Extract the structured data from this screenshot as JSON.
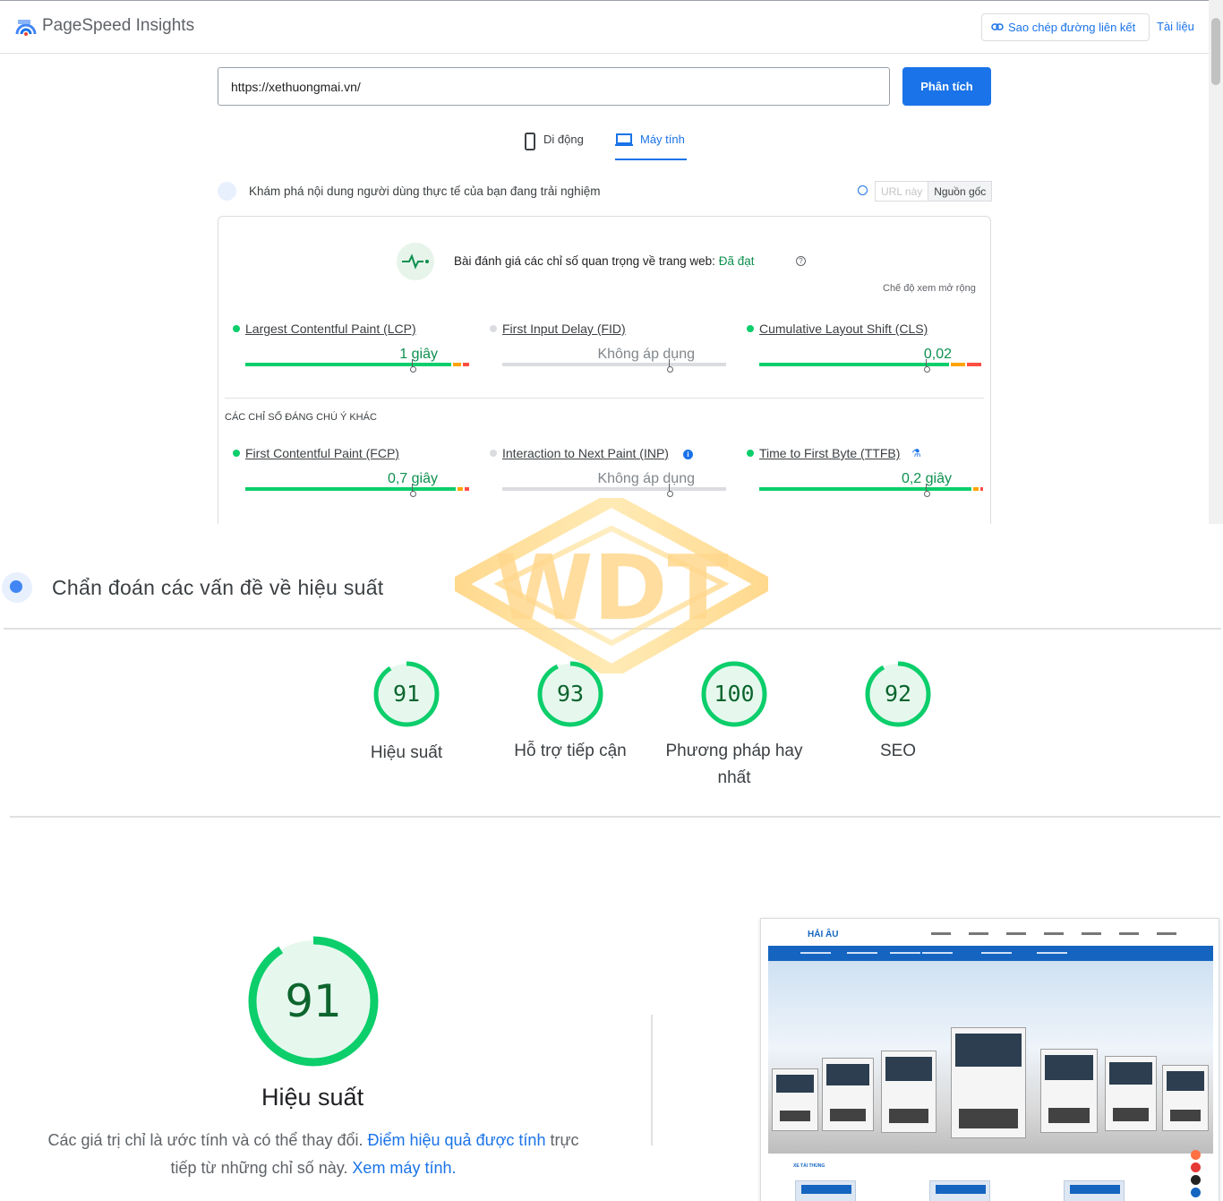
{
  "header": {
    "brand": "PageSpeed Insights",
    "copy_link": "Sao chép đường liên kết",
    "docs": "Tài liệu"
  },
  "search": {
    "url_value": "https://xethuongmai.vn/",
    "analyze_label": "Phân tích"
  },
  "tabs": [
    {
      "label": "Di động",
      "icon": "mobile-icon",
      "selected": false
    },
    {
      "label": "Máy tính",
      "icon": "desktop-icon",
      "selected": true
    }
  ],
  "field_data": {
    "title": "Khám phá nội dung người dùng thực tế của bạn đang trải nghiệm",
    "toggle": [
      "URL này",
      "Nguồn gốc"
    ],
    "toggle_selected": "Nguồn gốc",
    "assessment_text": "Bài đánh giá các chỉ số quan trọng về trang web:",
    "assessment_status": "Đã đạt",
    "expand_label": "Chế độ xem mở rộng",
    "other_metrics_label": "CÁC CHỈ SỐ ĐÁNG CHÚ Ý KHÁC",
    "metrics": [
      {
        "name": "Largest Contentful Paint (LCP)",
        "value": "1 giây",
        "status": "good"
      },
      {
        "name": "First Input Delay (FID)",
        "value": "Không áp dụng",
        "status": "na"
      },
      {
        "name": "Cumulative Layout Shift (CLS)",
        "value": "0,02",
        "status": "good"
      },
      {
        "name": "First Contentful Paint (FCP)",
        "value": "0,7 giây",
        "status": "good"
      },
      {
        "name": "Interaction to Next Paint (INP)",
        "value": "Không áp dụng",
        "status": "na"
      },
      {
        "name": "Time to First Byte (TTFB)",
        "value": "0,2 giây",
        "status": "good"
      }
    ]
  },
  "diagnostics": {
    "title": "Chẩn đoán các vấn đề về hiệu suất",
    "scores": [
      {
        "value": "91",
        "label": "Hiệu suất"
      },
      {
        "value": "93",
        "label": "Hỗ trợ tiếp cận"
      },
      {
        "value": "100",
        "label": "Phương pháp hay nhất"
      },
      {
        "value": "92",
        "label": "SEO"
      }
    ],
    "performance": {
      "score": "91",
      "title": "Hiệu suất",
      "note_text": "Các giá trị chỉ là ước tính và có thể thay đổi.",
      "note_link1": "Điểm hiệu quả được tính",
      "note_text2": "trực tiếp từ những chỉ số này.",
      "note_link2": "Xem máy tính."
    }
  },
  "thumbnail": {
    "logo": "HẢI ÂU",
    "section": "XE TẢI THÙNG"
  },
  "watermark": {
    "text": "WDT"
  },
  "colors": {
    "accent": "#1a73e8",
    "good": "#0cce6b",
    "average": "#ffa400",
    "poor": "#ff4e42",
    "good_text": "#0d904f"
  }
}
